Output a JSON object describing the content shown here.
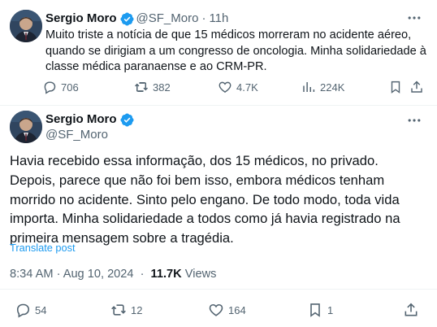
{
  "reply_tweet": {
    "author_name": "Sergio Moro",
    "author_handle": "@SF_Moro",
    "separator": "·",
    "time": "11h",
    "text": "Muito triste a notícia de que 15 médicos morreram no acidente aéreo, quando se dirigiam a um congresso de oncologia. Minha solidariedade à classe médica paranaense e ao CRM-PR.",
    "replies": "706",
    "reposts": "382",
    "likes": "4.7K",
    "views": "224K",
    "icons": [
      "reply-icon",
      "repost-icon",
      "like-icon",
      "views-icon",
      "bookmark-icon",
      "share-icon",
      "more-icon",
      "verified-badge-icon"
    ]
  },
  "main_tweet": {
    "author_name": "Sergio Moro",
    "author_handle": "@SF_Moro",
    "text": "Havia recebido essa informação, dos 15 médicos, no privado. Depois, parece que não foi bem isso, embora médicos tenham morrido no acidente. Sinto pelo engano. De todo modo, toda vida importa. Minha solidariedade a todos como já havia registrado na primeira mensagem sobre a tragédia.",
    "translate_label": "Translate post",
    "timestamp": "8:34 AM · Aug 10, 2024",
    "meta_separator": "·",
    "views_count": "11.7K",
    "views_label": "Views",
    "replies": "54",
    "reposts": "12",
    "likes": "164",
    "bookmarks": "1"
  },
  "colors": {
    "text": "#0f1419",
    "muted": "#536471",
    "accent": "#1d9bf0",
    "divider": "#eff3f4"
  }
}
